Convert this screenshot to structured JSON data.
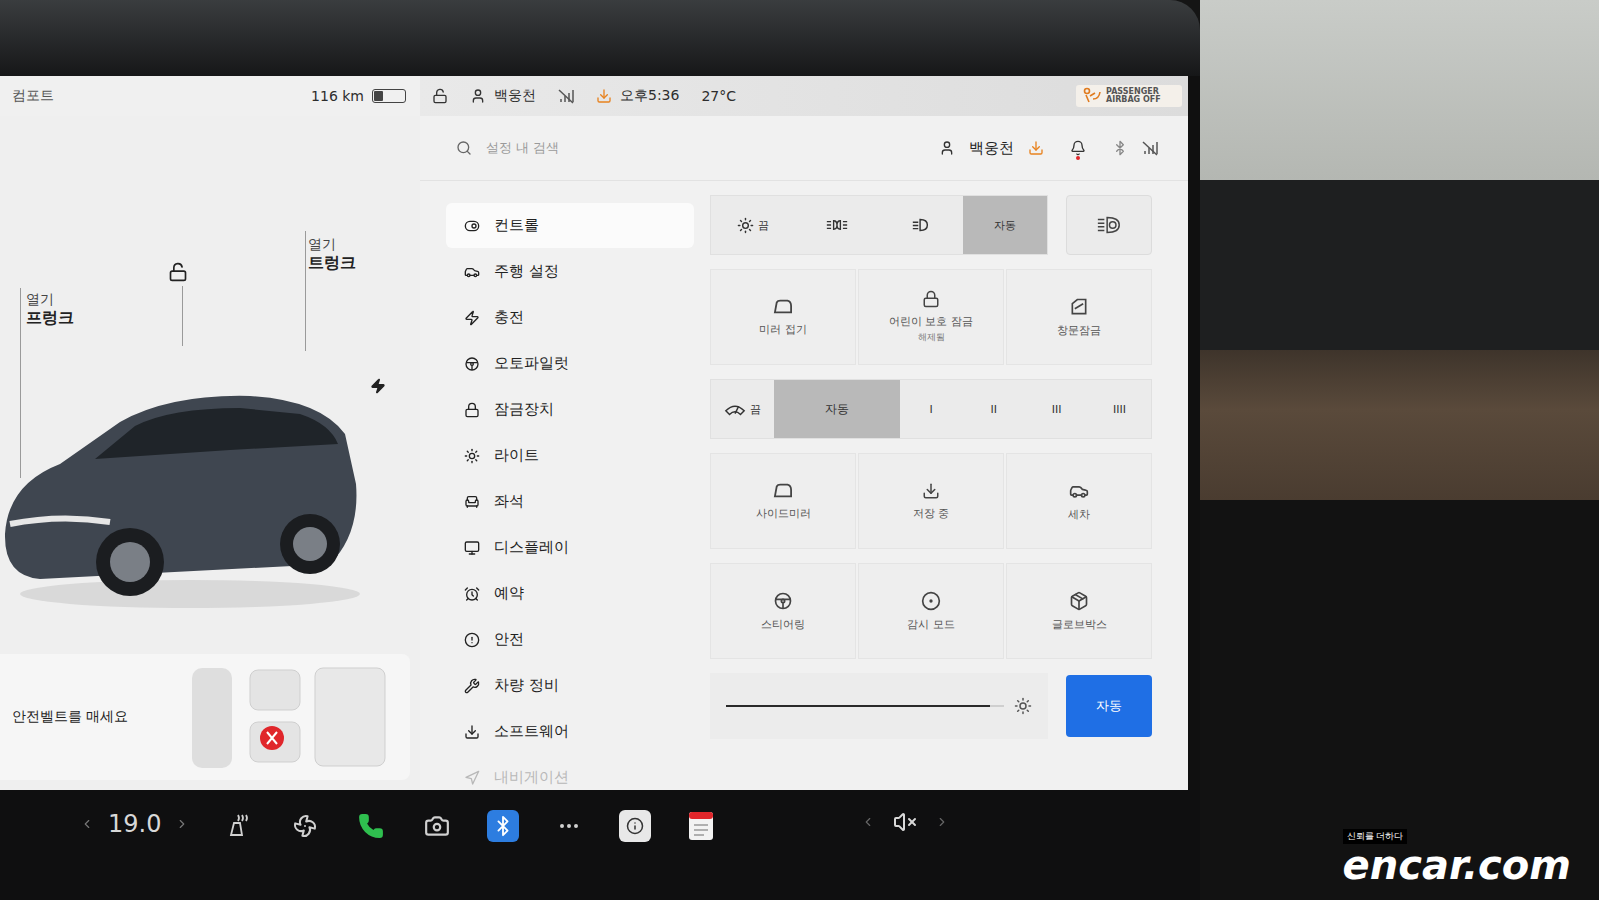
{
  "status_bar": {
    "mode": "컴포트",
    "range": "116 km",
    "battery_level": 0.3,
    "locked": false,
    "driver": "백웅천",
    "time": "오후5:36",
    "temperature": "27°C",
    "airbag": "PASSENGER AIRBAG OFF"
  },
  "car_panel": {
    "trunk": {
      "action": "열기",
      "label": "트렁크"
    },
    "frunk": {
      "action": "열기",
      "label": "프렁크"
    },
    "door_locked": false,
    "charging": true,
    "seatbelt": "안전벨트를 매세요"
  },
  "search": {
    "placeholder": "설정 내 검색",
    "user": "백웅천",
    "notification": true
  },
  "sidebar": {
    "items": [
      {
        "label": "컨트롤",
        "selected": true,
        "faded": false
      },
      {
        "label": "주행 설정",
        "selected": false,
        "faded": false
      },
      {
        "label": "충전",
        "selected": false,
        "faded": false
      },
      {
        "label": "오토파일럿",
        "selected": false,
        "faded": false
      },
      {
        "label": "잠금장치",
        "selected": false,
        "faded": false
      },
      {
        "label": "라이트",
        "selected": false,
        "faded": false
      },
      {
        "label": "좌석",
        "selected": false,
        "faded": false
      },
      {
        "label": "디스플레이",
        "selected": false,
        "faded": false
      },
      {
        "label": "예약",
        "selected": false,
        "faded": false
      },
      {
        "label": "안전",
        "selected": false,
        "faded": false
      },
      {
        "label": "차량 정비",
        "selected": false,
        "faded": false
      },
      {
        "label": "소프트웨어",
        "selected": false,
        "faded": false
      },
      {
        "label": "내비게이션",
        "selected": false,
        "faded": true
      }
    ]
  },
  "headlights": {
    "options": [
      {
        "kind": "off",
        "label": "끔",
        "selected": false
      },
      {
        "kind": "parking",
        "selected": false
      },
      {
        "kind": "low",
        "selected": false
      },
      {
        "kind": "auto",
        "label": "자동",
        "selected": true
      }
    ],
    "auto_high_beam": false
  },
  "tile_rows": [
    [
      {
        "label": "미러 접기"
      },
      {
        "label": "어린이 보호 잠금",
        "sub": "해제됨"
      },
      {
        "label": "창문잠금"
      }
    ],
    [
      {
        "label": "사이드미러"
      },
      {
        "label": "저장 중"
      },
      {
        "label": "세차"
      }
    ],
    [
      {
        "label": "스티어링"
      },
      {
        "label": "감시 모드"
      },
      {
        "label": "글로브박스"
      }
    ]
  ],
  "wipers": [
    {
      "kind": "off",
      "label": "끔",
      "selected": false
    },
    {
      "kind": "text",
      "label": "자동",
      "selected": true
    },
    {
      "kind": "text",
      "label": "I",
      "selected": false
    },
    {
      "kind": "text",
      "label": "II",
      "selected": false
    },
    {
      "kind": "text",
      "label": "III",
      "selected": false
    },
    {
      "kind": "text",
      "label": "IIII",
      "selected": false
    }
  ],
  "brightness": {
    "level": 0.95,
    "auto_label": "자동",
    "auto_on": true
  },
  "taskbar": {
    "temperature": "19.0",
    "muted": true
  },
  "watermark": {
    "tagline": "신뢰를 더하다",
    "brand": "encar.com"
  }
}
